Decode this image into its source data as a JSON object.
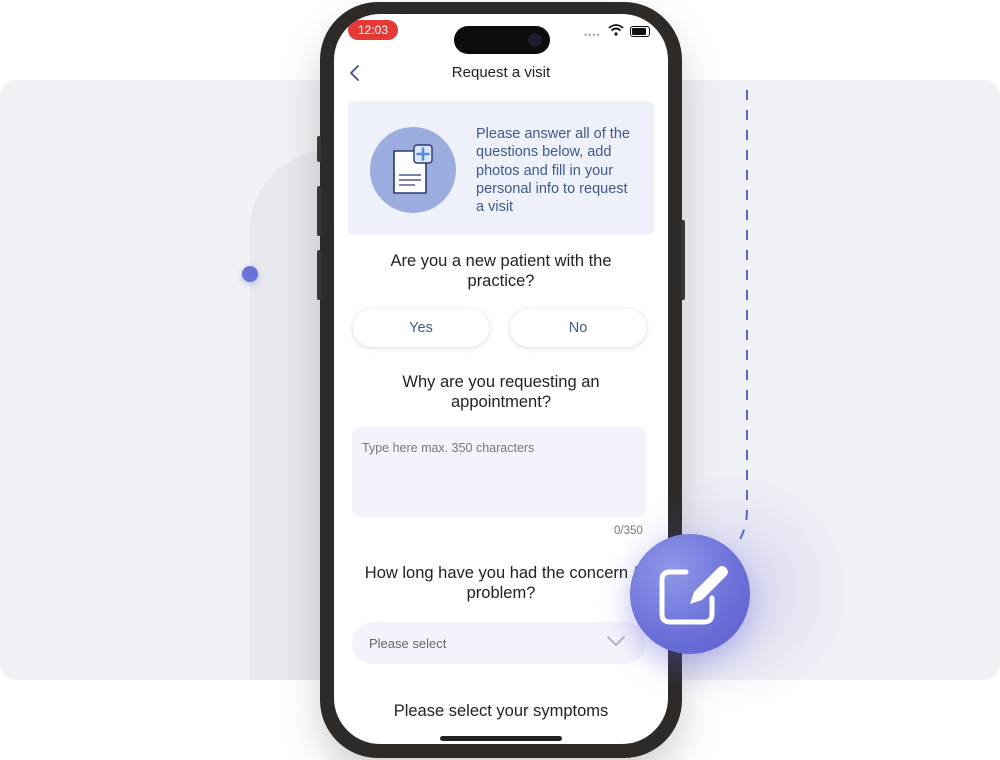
{
  "status_bar": {
    "time": "12:03",
    "dots": "••••"
  },
  "nav": {
    "title": "Request a visit",
    "back_icon": "chevron-left-icon"
  },
  "info_card": {
    "icon": "document-plus-icon",
    "text": "Please answer all of the questions below, add photos and fill in your personal info to request a visit"
  },
  "questions": {
    "new_patient": "Are you a new patient with the practice?",
    "reason": "Why are you requesting an appointment?",
    "duration": "How long have you had the concern / problem?",
    "symptoms": "Please select your symptoms"
  },
  "choices": {
    "yes": "Yes",
    "no": "No"
  },
  "reason_field": {
    "placeholder": "Type here max. 350 characters",
    "char_count": "0/350"
  },
  "duration_select": {
    "value": "Please select",
    "icon": "chevron-down-icon"
  },
  "fab": {
    "icon": "edit-icon"
  },
  "colors": {
    "accent": "#6a6fd8",
    "text_blue": "#3f5a8a",
    "card_bg": "#eef0fa",
    "time_pill": "#e53935"
  }
}
